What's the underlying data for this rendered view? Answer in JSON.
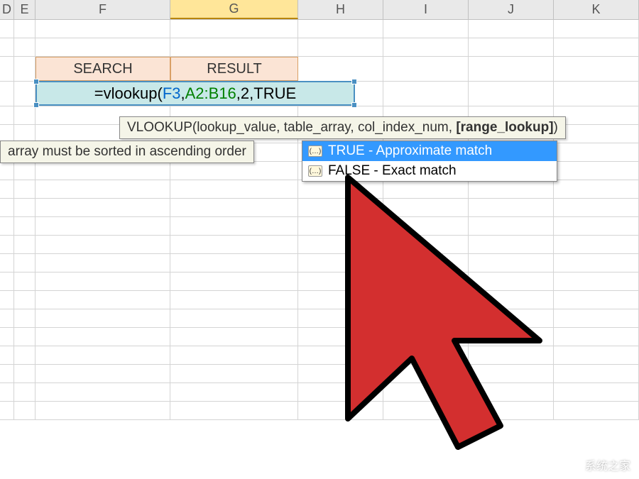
{
  "columns": [
    "D",
    "E",
    "F",
    "G",
    "H",
    "I",
    "J",
    "K"
  ],
  "activeColumn": "G",
  "headers": {
    "search": "SEARCH",
    "result": "RESULT"
  },
  "formula": {
    "prefix": "=vlookup(",
    "arg1": "F3",
    "comma1": ",",
    "arg2": "A2:B16",
    "comma2": ",",
    "arg3": "2",
    "comma3": ",",
    "arg4": "TRUE"
  },
  "syntax_tooltip": {
    "func": "VLOOKUP",
    "args": "(lookup_value, table_array, col_index_num, ",
    "current_arg": "[range_lookup]",
    "close": ")"
  },
  "hint": "array must be sorted in ascending order",
  "autocomplete": {
    "opt_true": "TRUE - Approximate match",
    "opt_false": "FALSE - Exact match"
  },
  "watermark": "系统之家"
}
